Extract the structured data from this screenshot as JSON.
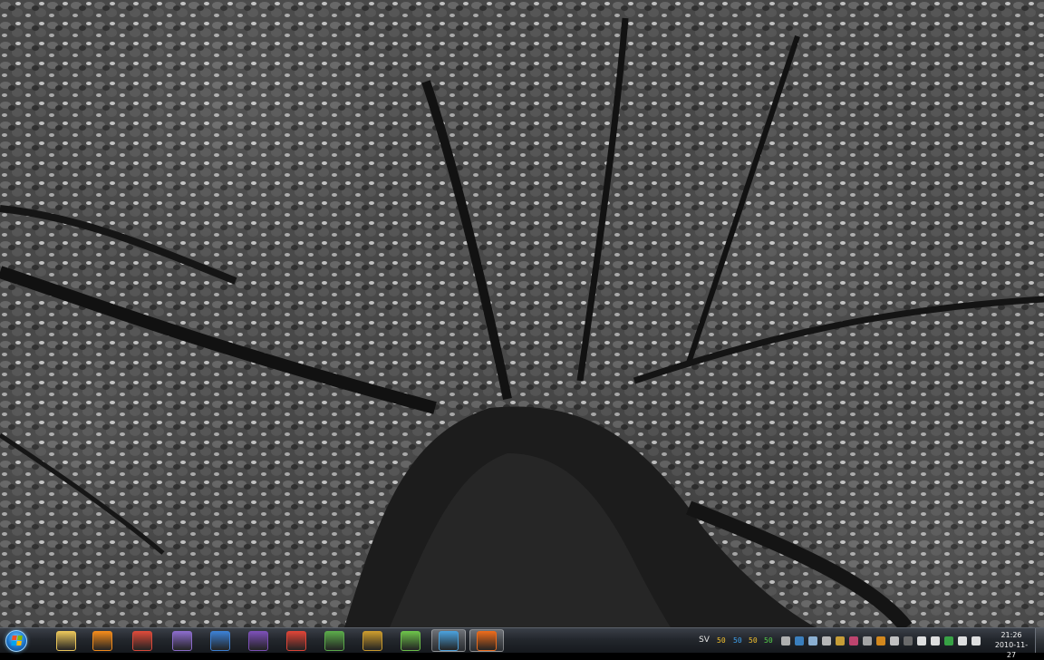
{
  "taskbar": {
    "start_icon": "windows-orb-icon",
    "pinned": [
      {
        "name": "explorer",
        "icon": "folder-icon",
        "color": "#e8c45a"
      },
      {
        "name": "media-player",
        "icon": "play-icon",
        "color": "#f08a1c"
      },
      {
        "name": "paint",
        "icon": "palette-icon",
        "color": "#d94a3a"
      },
      {
        "name": "pidgin",
        "icon": "chat-bird-icon",
        "color": "#8a6bc9"
      },
      {
        "name": "thunderbird",
        "icon": "mail-icon",
        "color": "#3c7fd1"
      },
      {
        "name": "visual-studio",
        "icon": "code-icon",
        "color": "#7b4fb5"
      },
      {
        "name": "chrome",
        "icon": "chrome-icon",
        "color": "#db4437"
      },
      {
        "name": "spreadsheet",
        "icon": "sheet-icon",
        "color": "#5aa84a"
      },
      {
        "name": "world-of-warcraft",
        "icon": "wow-icon",
        "color": "#c99a2e"
      },
      {
        "name": "chat-alien",
        "icon": "alien-icon",
        "color": "#6cc04a"
      },
      {
        "name": "network-users",
        "icon": "users-icon",
        "color": "#4a9ed8",
        "active": true
      },
      {
        "name": "firefox",
        "icon": "firefox-icon",
        "color": "#e86a1c",
        "active": true
      }
    ],
    "language": "SV",
    "tray_numbers": [
      {
        "value": "50",
        "color": "#f2c12e"
      },
      {
        "value": "50",
        "color": "#3fa3f0"
      },
      {
        "value": "50",
        "color": "#f2c12e"
      },
      {
        "value": "50",
        "color": "#55d14a"
      }
    ],
    "tray_icons": [
      {
        "icon": "bug-icon",
        "color": "#c8c8c8"
      },
      {
        "icon": "globe-icon",
        "color": "#3f8fd8"
      },
      {
        "icon": "chat-icon",
        "color": "#9dc8f0"
      },
      {
        "icon": "monitor-icon",
        "color": "#d0d0d0"
      },
      {
        "icon": "book-icon",
        "color": "#e4b33a"
      },
      {
        "icon": "heart-icon",
        "color": "#d84a7a"
      },
      {
        "icon": "gear-icon",
        "color": "#bbbbbb"
      },
      {
        "icon": "orange-dot-icon",
        "color": "#f29a1c"
      },
      {
        "icon": "skull-icon",
        "color": "#dddddd"
      },
      {
        "icon": "drive-icon",
        "color": "#777777"
      },
      {
        "icon": "flag-icon",
        "color": "#ffffff"
      },
      {
        "icon": "speech-icon",
        "color": "#ffffff"
      },
      {
        "icon": "shield-icon",
        "color": "#3cb84a"
      },
      {
        "icon": "network-icon",
        "color": "#ffffff"
      },
      {
        "icon": "volume-icon",
        "color": "#ffffff"
      }
    ],
    "clock": {
      "time": "21:26",
      "date": "2010-11-27"
    }
  }
}
